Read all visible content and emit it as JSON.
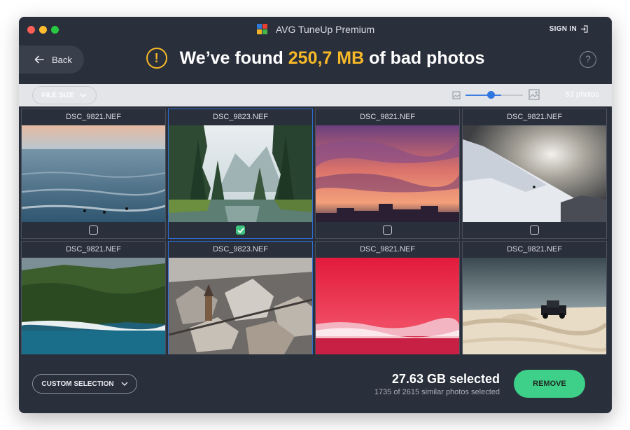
{
  "window": {
    "app_title": "AVG TuneUp Premium",
    "signin_label": "SIGN IN",
    "back_label": "Back"
  },
  "headline": {
    "prefix": "We’ve found",
    "amount": "250,7 MB",
    "suffix": "of bad photos",
    "warning_symbol": "!",
    "help_symbol": "?"
  },
  "toolbar": {
    "filesize_label": "FILE SIZE",
    "photo_count": "53 photos",
    "thumbnail_size_level": 0.45
  },
  "photos": [
    {
      "name": "DSC_9821.NEF",
      "checked": false,
      "scene": "ocean"
    },
    {
      "name": "DSC_9823.NEF",
      "checked": true,
      "scene": "forest-lake"
    },
    {
      "name": "DSC_9821.NEF",
      "checked": false,
      "scene": "sunset-sky"
    },
    {
      "name": "DSC_9821.NEF",
      "checked": false,
      "scene": "snow-mountain"
    },
    {
      "name": "DSC_9821.NEF",
      "checked": false,
      "scene": "jungle-coast"
    },
    {
      "name": "DSC_9823.NEF",
      "checked": false,
      "scene": "snowy-town"
    },
    {
      "name": "DSC_9821.NEF",
      "checked": false,
      "scene": "red-landscape"
    },
    {
      "name": "DSC_9821.NEF",
      "checked": false,
      "scene": "desert-truck"
    }
  ],
  "footer": {
    "custom_selection_label": "CUSTOM SELECTION",
    "selected_size": "27.63 GB selected",
    "selected_count": "1735 of 2615 similar photos selected",
    "remove_label": "REMOVE"
  },
  "colors": {
    "accent_yellow": "#f7b928",
    "accent_green": "#3ecf88",
    "accent_blue": "#2e76e0",
    "window_bg": "#2a2f3c"
  }
}
